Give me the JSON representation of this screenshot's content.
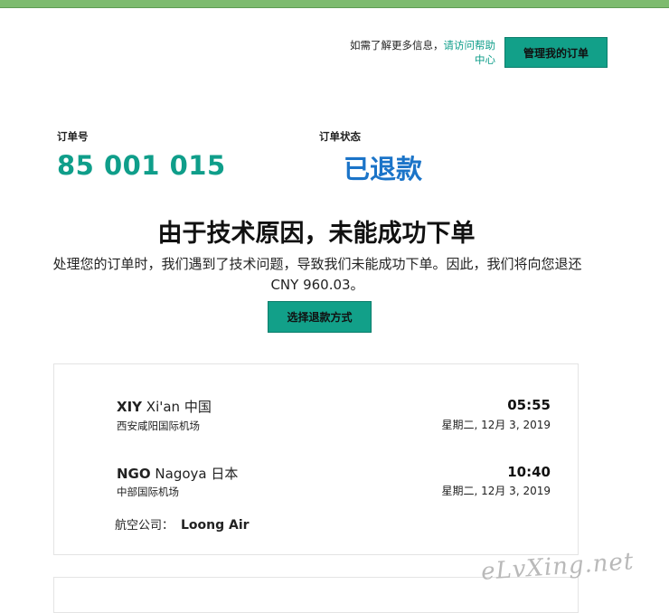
{
  "header": {
    "help_text": "如需了解更多信息，",
    "help_link": "请访问帮助中心",
    "manage_button": "管理我的订单"
  },
  "order": {
    "number_label": "订单号",
    "number": "85 001 015",
    "status_label": "订单状态",
    "status": "已退款"
  },
  "message": {
    "headline": "由于技术原因，未能成功下单",
    "description": "处理您的订单时，我们遇到了技术问题，导致我们未能成功下单。因此，我们将向您退还 CNY 960.03。",
    "refund_button": "选择退款方式"
  },
  "itinerary": {
    "departure": {
      "code": "XIY",
      "city": "Xi'an 中国",
      "airport": "西安咸阳国际机场",
      "time": "05:55",
      "date": "星期二, 12月 3, 2019"
    },
    "arrival": {
      "code": "NGO",
      "city": "Nagoya 日本",
      "airport": "中部国际机场",
      "time": "10:40",
      "date": "星期二, 12月 3, 2019"
    },
    "airline_label": "航空公司：",
    "airline": "Loong Air"
  },
  "watermark": "eLvXing.net",
  "colors": {
    "accent": "#12a089",
    "order_number": "#0f9e8a",
    "status": "#1b74c8",
    "top_bar": "#7dbb6f"
  }
}
